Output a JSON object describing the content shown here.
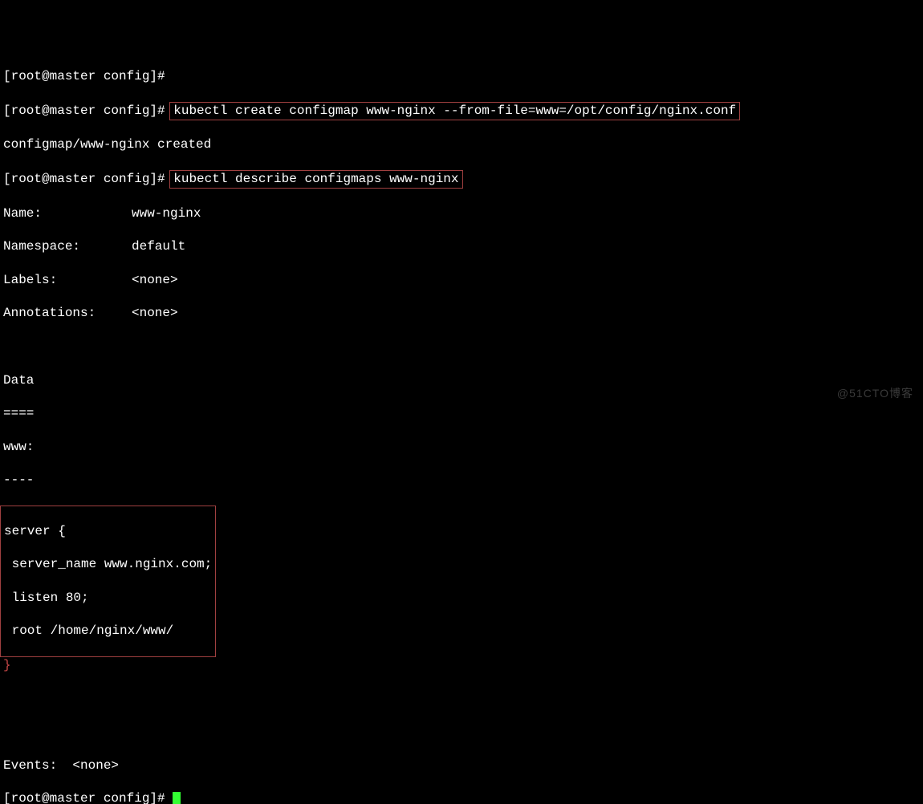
{
  "prompt1": "[root@master config]# ",
  "cmd1": "kubectl create configmap www-nginx --from-file=www=/opt/config/nginx.conf",
  "out1": "configmap/www-nginx created",
  "prompt2": "[root@master config]# ",
  "cmd2": "kubectl describe configmaps www-nginx",
  "desc": {
    "name_label": "Name:",
    "name_value": "www-nginx",
    "namespace_label": "Namespace:",
    "namespace_value": "default",
    "labels_label": "Labels:",
    "labels_value": "<none>",
    "annotations_label": "Annotations:",
    "annotations_value": "<none>",
    "data_header": "Data",
    "data_sep": "====",
    "key_header": "www:",
    "key_sep": "----",
    "server_open": "server {",
    "server_name": " server_name www.nginx.com;",
    "listen": " listen 80;",
    "root": " root /home/nginx/www/",
    "server_close": "}",
    "events_label": "Events:",
    "events_value": "<none>"
  },
  "prompt3": "[root@master config]# ",
  "watermark": "@51CTO博客"
}
